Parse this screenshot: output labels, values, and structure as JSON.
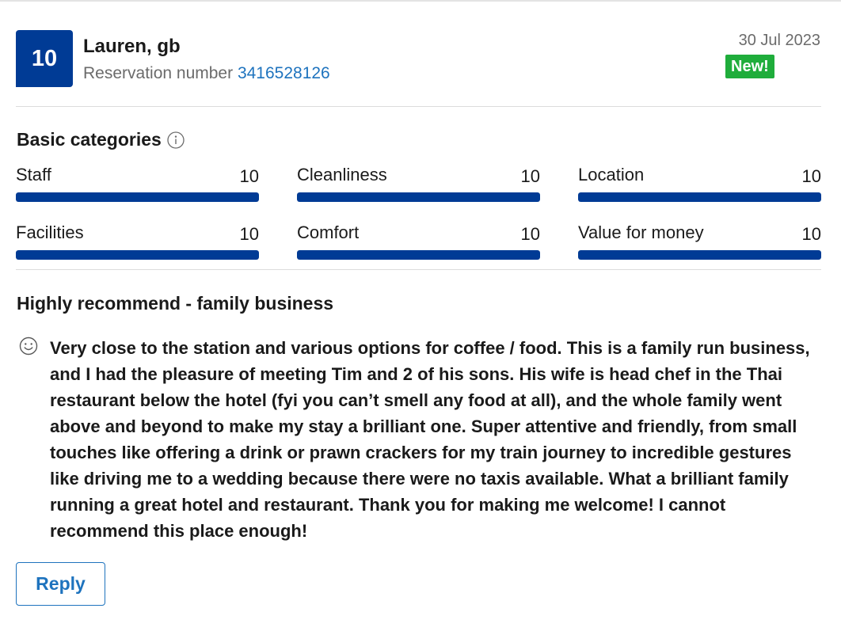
{
  "review": {
    "score": "10",
    "reviewer": "Lauren, gb",
    "reservation_label": "Reservation number",
    "reservation_number": "3416528126",
    "date": "30 Jul 2023",
    "new_badge": "New!"
  },
  "categories": {
    "title": "Basic categories",
    "info_icon": "info-circle-icon",
    "items": [
      {
        "label": "Staff",
        "value": "10",
        "fraction": 1.0
      },
      {
        "label": "Cleanliness",
        "value": "10",
        "fraction": 1.0
      },
      {
        "label": "Location",
        "value": "10",
        "fraction": 1.0
      },
      {
        "label": "Facilities",
        "value": "10",
        "fraction": 1.0
      },
      {
        "label": "Comfort",
        "value": "10",
        "fraction": 1.0
      },
      {
        "label": "Value for money",
        "value": "10",
        "fraction": 1.0
      }
    ]
  },
  "review_body": {
    "title": "Highly recommend - family business",
    "icon": "smiley-icon",
    "text": "Very close to the station and various options for coffee / food. This is a family run business, and I had the pleasure of meeting Tim and 2 of his sons. His wife is head chef in the Thai restaurant below the hotel (fyi you can’t smell any food at all), and the whole family went above and beyond to make my stay a brilliant one. Super attentive and friendly, from small touches like offering a drink or prawn crackers for my train journey to incredible gestures like driving me to a wedding because there were no taxis available. What a brilliant family running a great hotel and restaurant. Thank you for making me welcome! I cannot recommend this place enough!"
  },
  "actions": {
    "reply_label": "Reply"
  },
  "colors": {
    "brand_blue": "#003b95",
    "link_blue": "#1e73be",
    "new_green": "#1fad3b"
  }
}
